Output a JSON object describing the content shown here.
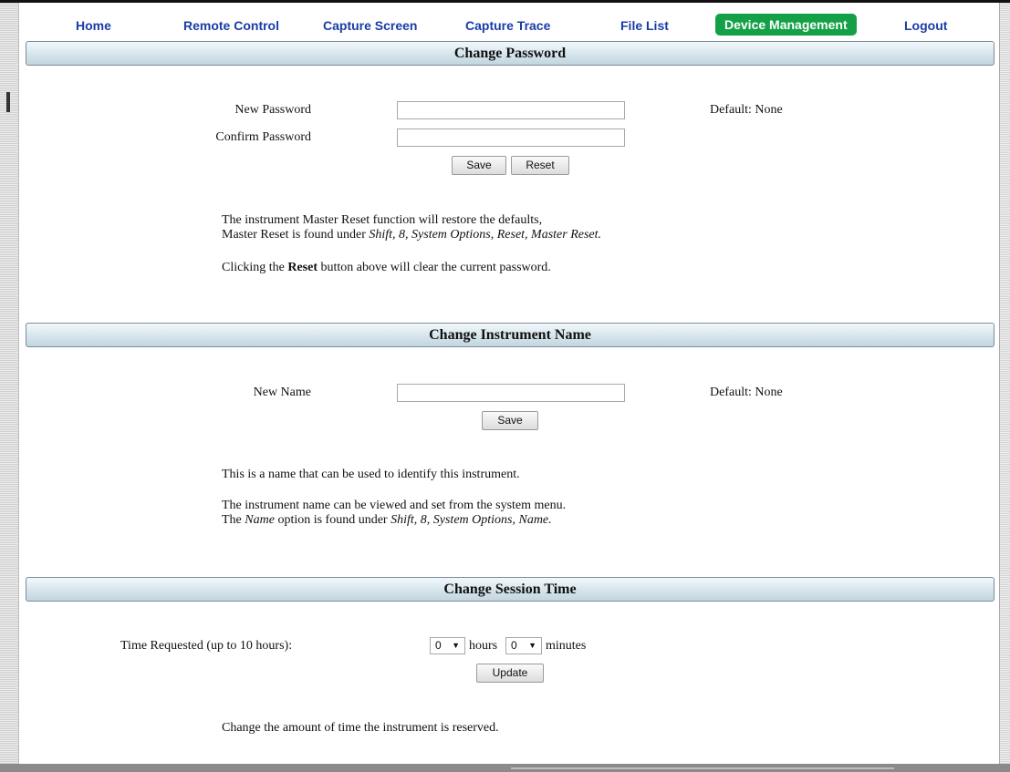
{
  "nav": {
    "items": [
      {
        "label": "Home"
      },
      {
        "label": "Remote Control"
      },
      {
        "label": "Capture Screen"
      },
      {
        "label": "Capture Trace"
      },
      {
        "label": "File List"
      },
      {
        "label": "Device Management",
        "active": true
      },
      {
        "label": "Logout"
      }
    ],
    "active_color": "#13a047",
    "link_color": "#1a3ca8"
  },
  "password": {
    "title": "Change Password",
    "new_label": "New Password",
    "confirm_label": "Confirm Password",
    "new_value": "",
    "confirm_value": "",
    "default_text": "Default: None",
    "save_label": "Save",
    "reset_label": "Reset",
    "info_line1": "The instrument Master Reset function will restore the defaults,",
    "info_line2_prefix": "Master Reset is found under ",
    "info_line2_path": "Shift, 8, System Options, Reset, Master Reset.",
    "info_line3_prefix": "Clicking the ",
    "info_line3_bold": "Reset",
    "info_line3_suffix": " button above will clear the current password."
  },
  "instrument_name": {
    "title": "Change Instrument Name",
    "name_label": "New Name",
    "name_value": "",
    "default_text": "Default: None",
    "save_label": "Save",
    "info_line1": "This is a name that can be used to identify this instrument.",
    "info_line2": "The instrument name can be viewed and set from the system menu.",
    "info_line3_prefix": "The ",
    "info_line3_name": "Name",
    "info_line3_mid": " option is found under ",
    "info_line3_path": "Shift, 8, System Options, Name."
  },
  "session": {
    "title": "Change Session Time",
    "time_label": "Time Requested (up to 10 hours):",
    "hours_value": "0",
    "hours_unit": "hours",
    "minutes_value": "0",
    "minutes_unit": "minutes",
    "update_label": "Update",
    "info": "Change the amount of time the instrument is reserved."
  }
}
